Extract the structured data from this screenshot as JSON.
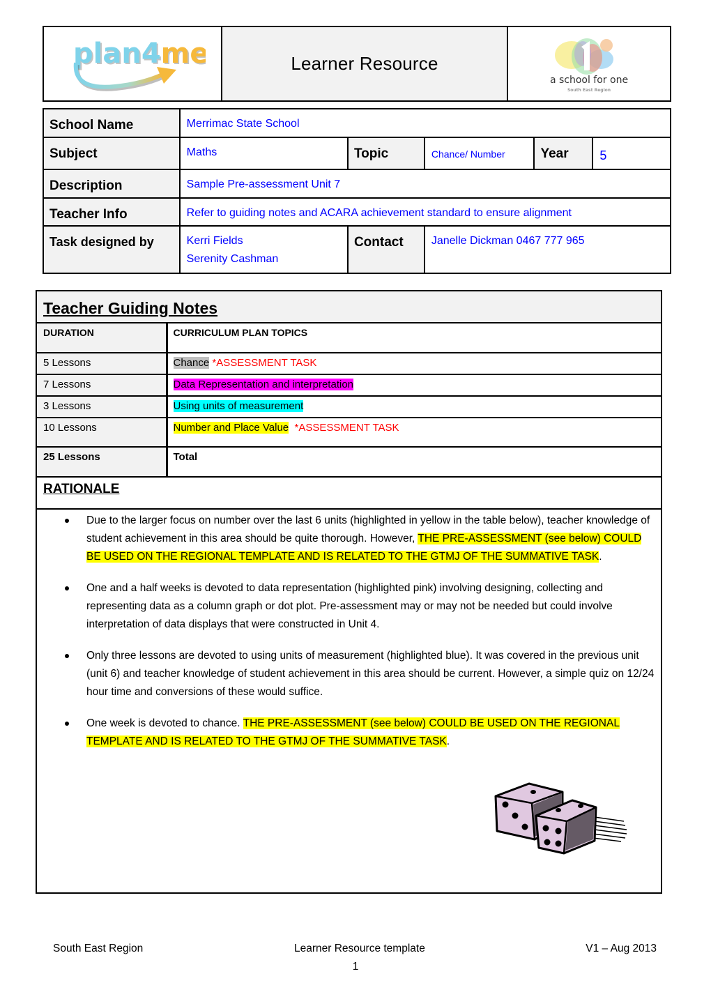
{
  "header": {
    "title": "Learner Resource",
    "logo_left": {
      "icon": "plan4me-logo",
      "text_part1": "plan4",
      "text_part2": "me"
    },
    "logo_right": {
      "icon": "school-for-one-logo",
      "text": "a school for one",
      "subtext": "South East Region"
    }
  },
  "info": {
    "school_name_label": "School Name",
    "school_name": "Merrimac  State School",
    "subject_label": "Subject",
    "subject": "Maths",
    "topic_label": "Topic",
    "topic": "Chance/ Number",
    "year_label": "Year",
    "year": "5",
    "description_label": "Description",
    "description": "Sample Pre-assessment Unit 7",
    "teacher_info_label": "Teacher Info",
    "teacher_info": "Refer to guiding notes and ACARA achievement standard to ensure alignment",
    "designed_by_label": "Task designed by",
    "designed_by": [
      "Kerri Fields",
      "Serenity Cashman"
    ],
    "contact_label": "Contact",
    "contact": "Janelle Dickman 0467 777 965"
  },
  "guiding_notes": {
    "title": "Teacher Guiding Notes",
    "columns": [
      "DURATION",
      "CURRICULUM PLAN TOPICS"
    ],
    "rows": [
      {
        "duration": "5 Lessons",
        "topic": "Chance",
        "highlight": "#c0c0c0",
        "note": "*ASSESSMENT TASK"
      },
      {
        "duration": "7 Lessons",
        "topic": "Data Representation and interpretation",
        "highlight": "#ff00ff",
        "note": ""
      },
      {
        "duration": "3 Lessons",
        "topic": "Using units of measurement",
        "highlight": "#00ffff",
        "note": ""
      },
      {
        "duration": "10 Lessons",
        "topic": "Number and Place Value",
        "highlight": "#ffff00",
        "note": "*ASSESSMENT TASK"
      }
    ],
    "total": {
      "duration": "25 Lessons",
      "label": "Total"
    }
  },
  "rationale": {
    "title": "RATIONALE",
    "bullets": [
      {
        "plain": "Due to the larger focus on number over the last 6 units (highlighted in yellow in the table below), teacher knowledge of student achievement in this area should be quite thorough. However,   ",
        "highlighted": "THE PRE-ASSESSMENT (see below) COULD BE USED ON THE REGIONAL TEMPLATE AND IS RELATED TO THE GTMJ OF THE SUMMATIVE TASK",
        "tail": "."
      },
      {
        "plain": "One and a half weeks is devoted to data representation (highlighted pink) involving designing, collecting and representing data as a column graph or dot plot. Pre-assessment may or may not be needed but could involve interpretation of data displays that were constructed in Unit 4.",
        "highlighted": "",
        "tail": ""
      },
      {
        "plain": "Only three lessons are devoted to using units of measurement (highlighted blue). It was covered in the previous unit (unit 6) and teacher knowledge of student achievement in this area should be current. However, a simple quiz on 12/24 hour time and conversions of these would suffice.",
        "highlighted": "",
        "tail": ""
      },
      {
        "plain": "One week is devoted to chance. ",
        "highlighted": "THE PRE-ASSESSMENT (see below) COULD BE USED ON THE REGIONAL TEMPLATE AND IS RELATED TO THE GTMJ OF THE SUMMATIVE TASK",
        "tail": "."
      }
    ],
    "image": "dice-icon"
  },
  "colors": {
    "value_text": "#0000ff",
    "assessment_text": "#ff0000",
    "label_bg": "#f2f2f2",
    "highlight_yellow": "#ffff00",
    "dice_fill": "#e0c8e0"
  },
  "footer": {
    "left": "South East Region",
    "center": "Learner Resource template",
    "right": "V1 – Aug 2013",
    "page_number": "1"
  }
}
